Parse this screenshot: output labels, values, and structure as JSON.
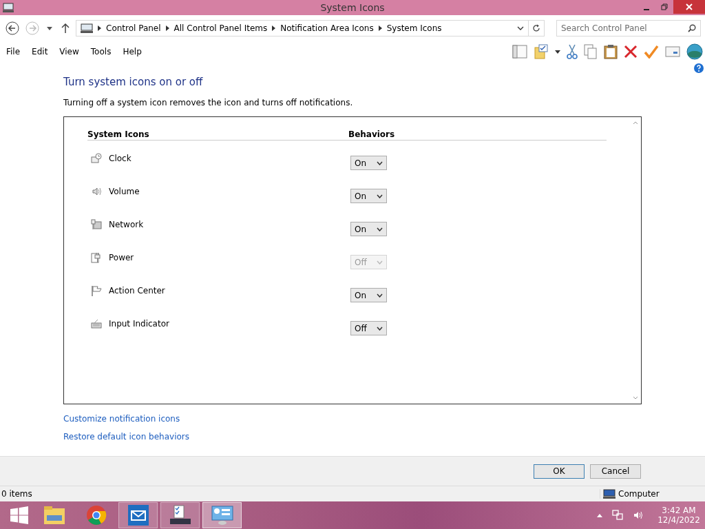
{
  "window": {
    "title": "System Icons"
  },
  "address": {
    "crumbs": [
      "Control Panel",
      "All Control Panel Items",
      "Notification Area Icons",
      "System Icons"
    ],
    "search_placeholder": "Search Control Panel"
  },
  "menu": [
    "File",
    "Edit",
    "View",
    "Tools",
    "Help"
  ],
  "heading": "Turn system icons on or off",
  "description": "Turning off a system icon removes the icon and turns off notifications.",
  "table": {
    "columns": [
      "System Icons",
      "Behaviors"
    ],
    "rows": [
      {
        "label": "Clock",
        "value": "On",
        "disabled": false
      },
      {
        "label": "Volume",
        "value": "On",
        "disabled": false
      },
      {
        "label": "Network",
        "value": "On",
        "disabled": false
      },
      {
        "label": "Power",
        "value": "Off",
        "disabled": true
      },
      {
        "label": "Action Center",
        "value": "On",
        "disabled": false
      },
      {
        "label": "Input Indicator",
        "value": "Off",
        "disabled": false
      }
    ]
  },
  "links": [
    "Customize notification icons",
    "Restore default icon behaviors"
  ],
  "buttons": [
    {
      "label": "OK",
      "default": true
    },
    {
      "label": "Cancel",
      "default": false
    }
  ],
  "status_bar": {
    "items": "0 items",
    "location": "Computer"
  },
  "taskbar": {
    "apps": [
      {
        "open": false,
        "selected": false
      },
      {
        "open": false,
        "selected": false
      },
      {
        "open": true,
        "selected": false
      },
      {
        "open": true,
        "selected": false
      },
      {
        "open": true,
        "selected": true
      }
    ],
    "time": "3:42 AM",
    "date": "12/4/2022"
  }
}
